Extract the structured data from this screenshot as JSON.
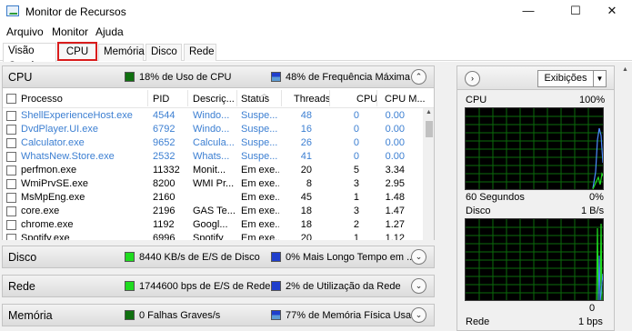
{
  "window": {
    "title": "Monitor de Recursos",
    "minimize_glyph": "—",
    "maximize_glyph": "☐",
    "close_glyph": "✕"
  },
  "menu": [
    "Arquivo",
    "Monitor",
    "Ajuda"
  ],
  "tabs": [
    {
      "label": "Visão Geral",
      "active": true
    },
    {
      "label": "CPU",
      "active": false,
      "highlighted": true
    },
    {
      "label": "Memória",
      "active": false
    },
    {
      "label": "Disco",
      "active": false
    },
    {
      "label": "Rede",
      "active": false
    }
  ],
  "colors": {
    "green": "#1fdc1f",
    "blue": "#1f3fcc",
    "dark_green": "#107010",
    "light_blue": "#5b9bd5",
    "highlight": "#d91c1c",
    "link_blue": "#3c7fd2"
  },
  "sections": {
    "cpu": {
      "title": "CPU",
      "stat1": "18% de Uso de CPU",
      "stat2": "48% de Frequência Máxima",
      "expanded": true,
      "chevron": "⌃"
    },
    "disk": {
      "title": "Disco",
      "stat1": "8440 KB/s de E/S de Disco",
      "stat2": "0% Mais Longo Tempo em ...",
      "chevron": "⌄"
    },
    "net": {
      "title": "Rede",
      "stat1": "1744600 bps de E/S de Rede",
      "stat2": "2% de Utilização da Rede",
      "chevron": "⌄"
    },
    "mem": {
      "title": "Memória",
      "stat1": "0 Falhas Graves/s",
      "stat2": "77% de Memória Física Usa...",
      "chevron": "⌄"
    }
  },
  "cpu_table": {
    "columns": [
      "Processo",
      "PID",
      "Descriç...",
      "Status",
      "Threads",
      "CPU",
      "CPU M..."
    ],
    "rows": [
      {
        "name": "ShellExperienceHost.exe",
        "pid": "4544",
        "desc": "Windo...",
        "status": "Suspe...",
        "threads": "48",
        "cpu": "0",
        "avg": "0.00",
        "suspended": true
      },
      {
        "name": "DvdPlayer.UI.exe",
        "pid": "6792",
        "desc": "Windo...",
        "status": "Suspe...",
        "threads": "16",
        "cpu": "0",
        "avg": "0.00",
        "suspended": true
      },
      {
        "name": "Calculator.exe",
        "pid": "9652",
        "desc": "Calcula...",
        "status": "Suspe...",
        "threads": "26",
        "cpu": "0",
        "avg": "0.00",
        "suspended": true
      },
      {
        "name": "WhatsNew.Store.exe",
        "pid": "2532",
        "desc": "Whats...",
        "status": "Suspe...",
        "threads": "41",
        "cpu": "0",
        "avg": "0.00",
        "suspended": true
      },
      {
        "name": "perfmon.exe",
        "pid": "11332",
        "desc": "Monit...",
        "status": "Em exe...",
        "threads": "20",
        "cpu": "5",
        "avg": "3.34",
        "suspended": false
      },
      {
        "name": "WmiPrvSE.exe",
        "pid": "8200",
        "desc": "WMI Pr...",
        "status": "Em exe...",
        "threads": "8",
        "cpu": "3",
        "avg": "2.95",
        "suspended": false
      },
      {
        "name": "MsMpEng.exe",
        "pid": "2160",
        "desc": "",
        "status": "Em exe...",
        "threads": "45",
        "cpu": "1",
        "avg": "1.48",
        "suspended": false
      },
      {
        "name": "core.exe",
        "pid": "2196",
        "desc": "GAS Te...",
        "status": "Em exe...",
        "threads": "18",
        "cpu": "3",
        "avg": "1.47",
        "suspended": false
      },
      {
        "name": "chrome.exe",
        "pid": "1192",
        "desc": "Googl...",
        "status": "Em exe...",
        "threads": "18",
        "cpu": "2",
        "avg": "1.27",
        "suspended": false
      },
      {
        "name": "Spotify.exe",
        "pid": "6996",
        "desc": "Spotify",
        "status": "Em exe...",
        "threads": "20",
        "cpu": "1",
        "avg": "1.12",
        "suspended": false
      }
    ]
  },
  "right_panel": {
    "expand_glyph": "›",
    "views_label": "Exibições",
    "views_drop": "▼",
    "cpu_graph": {
      "title": "CPU",
      "max": "100%",
      "time": "60 Segundos",
      "min": "0%"
    },
    "disk_graph": {
      "title": "Disco",
      "max": "1 B/s",
      "min": "0"
    },
    "net_graph": {
      "title": "Rede",
      "max": "1 bps"
    }
  },
  "scroll_glyph_up": "▲"
}
